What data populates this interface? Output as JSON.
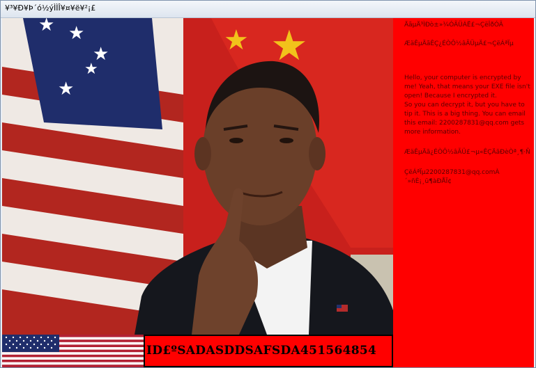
{
  "window": {
    "title": "¥³¥Ð¥Þ´ó½ýÌÌÎ¥¤¥ë¥²¡£"
  },
  "ransom_panel": {
    "garbled_line_1": "ÄãµÄ³ÌÐò±»¼ÓÃÜÁË£¬ÇëÎðÓÃ",
    "garbled_line_2": "ÆäÊµÄãÊÇ¿ÉÒÔ½âÃÜµÄ£¬ÇëÁªÏµ",
    "message": "Hello, your computer is encrypted by me! Yeah, that means your EXE file isn't open! Because I encrypted it.\nSo you can decrypt it, but you have to tip it. This is a big thing. You can email this email: 2200287831@qq.com gets more information.",
    "garbled_line_3": "ÆäÊµÄã¿ÉÒÔ½âÃÜ£¬µ«ÊÇÄãÐèÒª¸¶·Ñ",
    "garbled_line_4": "ÇëÁªÏµ2200287831@qq.comÀ´»ñÈ¡¸ü¶àÐÅÏ¢"
  },
  "id_box": {
    "text": "ID£ºSADASDDSAFSDA451564854"
  },
  "colors": {
    "panel_red": "#ff0000",
    "text_dark_red": "#5a0000",
    "flag_blue": "#1f2d6b",
    "flag_red": "#b22234"
  },
  "icons": [
    "us-flag-photo",
    "china-flag-photo",
    "us-flag-banner"
  ]
}
